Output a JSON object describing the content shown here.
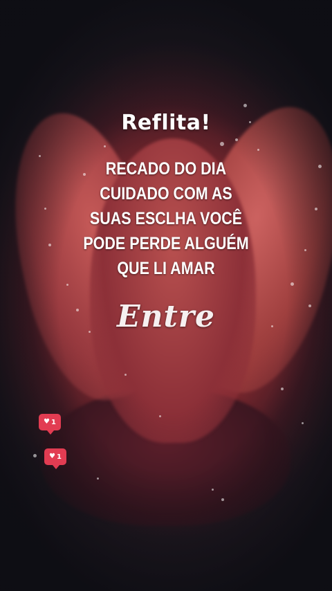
{
  "post": {
    "title": "Reflita!",
    "message_lines": [
      "RECADO DO DIA",
      "CUIDADO COM AS",
      "SUAS ESCLHA VOCÊ",
      "PODE PERDE ALGUÉM",
      "QUE LI AMAR"
    ],
    "signature": "Entre"
  },
  "reactions": [
    {
      "icon": "heart-icon",
      "count": "1"
    },
    {
      "icon": "heart-icon",
      "count": "1"
    }
  ],
  "colors": {
    "like_badge": "#e23c52",
    "text": "#ffffff",
    "background": "#16161c",
    "flower": "#b8504f"
  }
}
